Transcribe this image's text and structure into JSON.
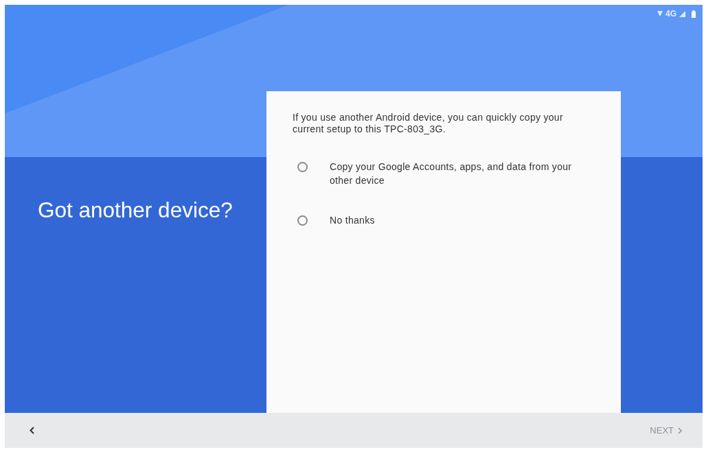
{
  "status_bar": {
    "network": "4G"
  },
  "heading": "Got another device?",
  "card": {
    "intro": "If you use another Android device, you can quickly copy your current setup to this TPC-803_3G.",
    "options": [
      {
        "label": "Copy your Google Accounts, apps, and data from your other device",
        "selected": false
      },
      {
        "label": "No thanks",
        "selected": false
      }
    ]
  },
  "footer": {
    "next": {
      "label": "NEXT",
      "disabled": true
    }
  }
}
